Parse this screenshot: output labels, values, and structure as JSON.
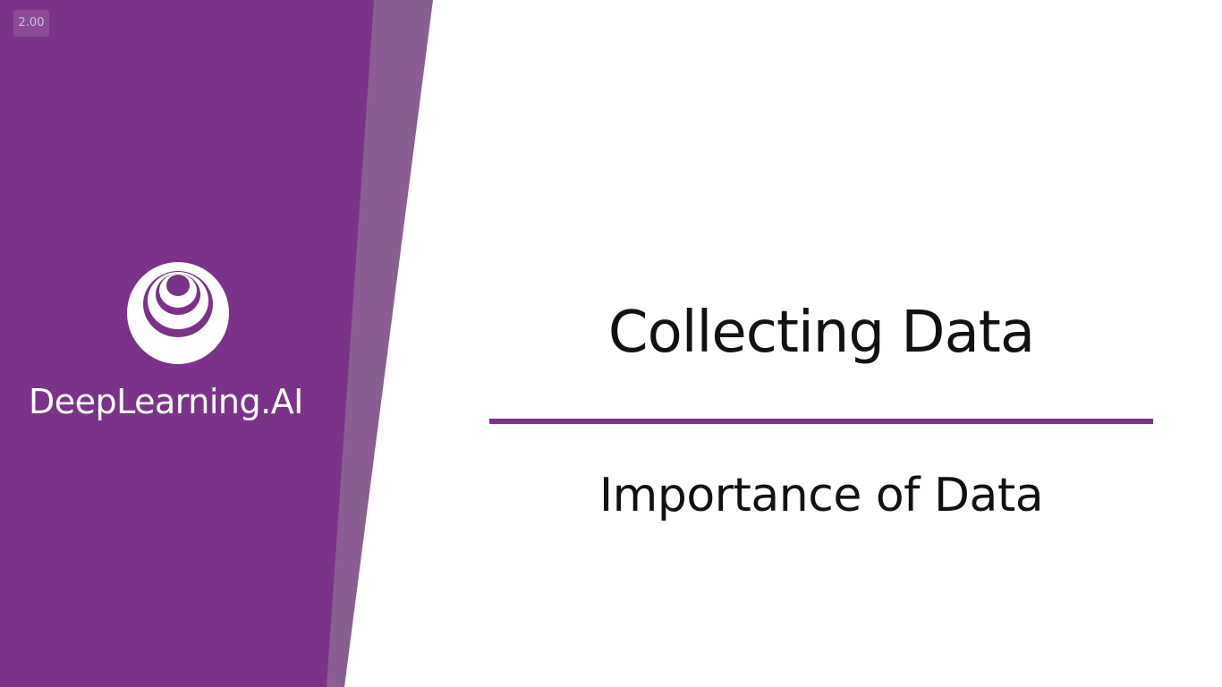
{
  "player": {
    "speed": "2.00"
  },
  "brand": {
    "name": "DeepLearning.AI",
    "logo_icon": "deeplearning-ai-logo-icon",
    "primary_color": "#7b3389",
    "secondary_color": "#8a5e93"
  },
  "slide": {
    "title": "Collecting Data",
    "subtitle": "Importance of Data",
    "rule_color": "#7b3389"
  }
}
